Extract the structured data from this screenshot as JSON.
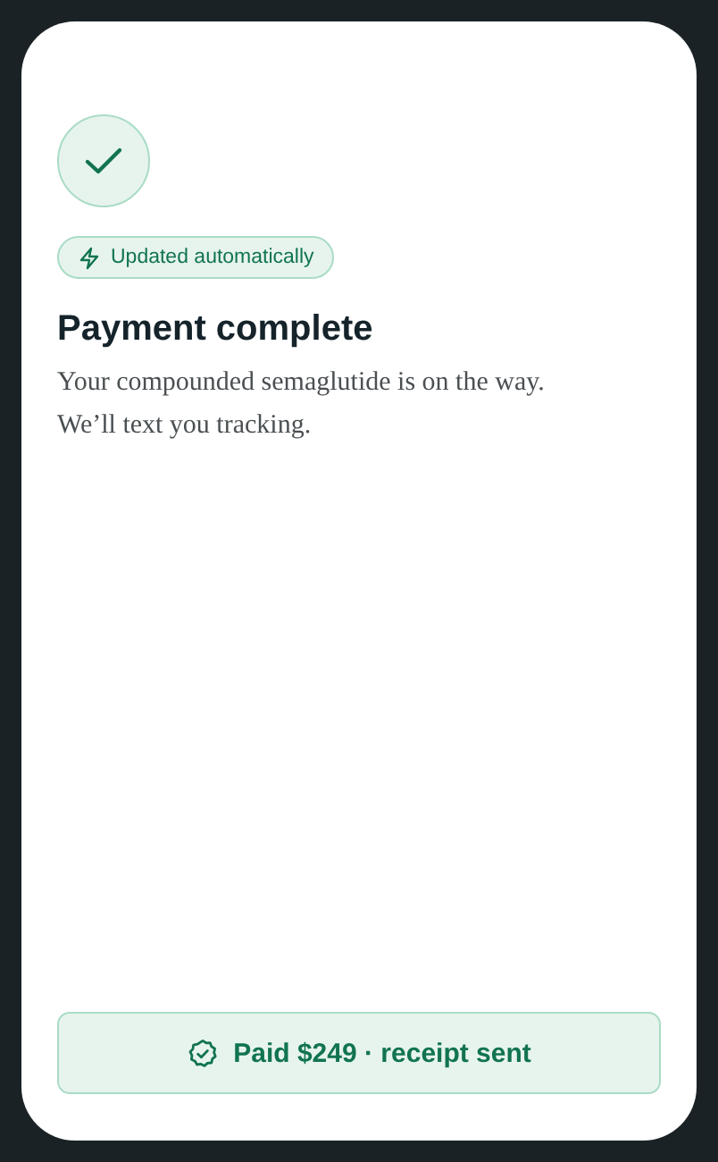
{
  "badge": {
    "label": "Updated automatically"
  },
  "title": "Payment complete",
  "message_lines": [
    "Your compounded semaglutide is on the way.",
    "We’ll text you tracking."
  ],
  "status_banner": {
    "label": "Paid $249 · receipt sent"
  }
}
